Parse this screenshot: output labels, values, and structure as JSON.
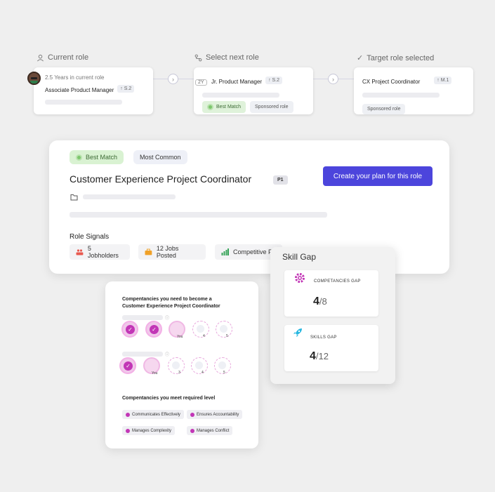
{
  "steps": [
    {
      "icon": "person-icon",
      "label": "Current role"
    },
    {
      "icon": "route-icon",
      "label": "Select next role"
    },
    {
      "icon": "check-icon",
      "label": "Target role selected"
    }
  ],
  "current_role": {
    "years": "2.5 Years in current role",
    "title": "Associate Product Manager",
    "level": "↑ S.2"
  },
  "next_role": {
    "years_chip": "2Y",
    "title": "Jr. Product Manager",
    "level": "↑ S.2",
    "best_match": "Best Match",
    "sponsored": "Sponsored role"
  },
  "target_role": {
    "title": "CX Project Coordinator",
    "level": "↑ M.1",
    "sponsored": "Sponsored role"
  },
  "main": {
    "best_match": "Best Match",
    "most_common": "Most Common",
    "title": "Customer Experience Project Coordinator",
    "priority": "P1",
    "cta": "Create your plan for this role",
    "signals_title": "Role Signals",
    "signals": [
      {
        "icon": "people-icon",
        "label": "5 Jobholders",
        "color": "#e8594f"
      },
      {
        "icon": "briefcase-icon",
        "label": "12 Jobs Posted",
        "color": "#f0a128"
      },
      {
        "icon": "bar-chart-icon",
        "label": "Competitive F",
        "color": "#3ba55c"
      }
    ]
  },
  "skill_gap": {
    "title": "Skill Gap",
    "competencies": {
      "label": "COMPETANCIES GAP",
      "value": "4",
      "total": "/8"
    },
    "skills": {
      "label": "SKILLS GAP",
      "value": "4",
      "total": "/12"
    }
  },
  "competency": {
    "title": "Compentancies you need to become a Customer Experience Project Coordinator",
    "rows": [
      {
        "marks": [
          "",
          "",
          "You",
          "4",
          "5"
        ]
      },
      {
        "marks": [
          "",
          "You",
          "3",
          "4",
          "5"
        ]
      }
    ],
    "met_title": "Compentancies you meet required level",
    "met": [
      "Communicates Effectively",
      "Ensures Accountability",
      "Manages Complexity",
      "Manages Conflict"
    ]
  },
  "colors": {
    "accent": "#4c45dc",
    "magenta": "#c236b6",
    "green": "#7cc76c"
  }
}
